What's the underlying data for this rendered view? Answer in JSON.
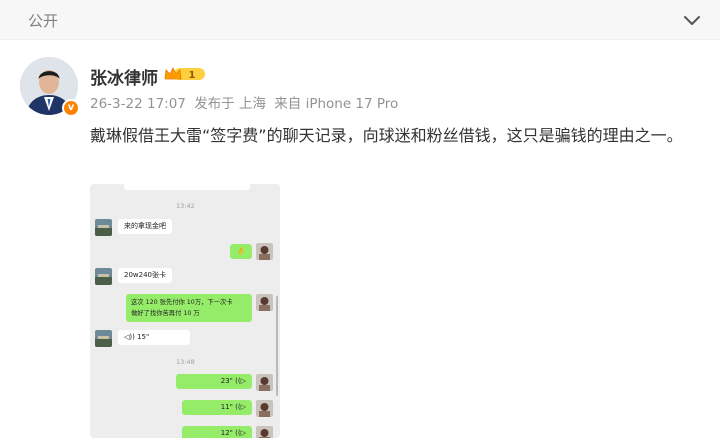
{
  "header": {
    "visibility": "公开"
  },
  "author": {
    "name": "张冰律师",
    "level": "1",
    "verified_mark": "v",
    "date": "26-3-22 17:07",
    "published_from": "发布于 上海",
    "device": "来自 iPhone 17 Pro"
  },
  "post": {
    "text": "戴琳假借王大雷“签字费”的聊天记录，向球迷和粉丝借钱，这只是骗钱的理由之一。"
  },
  "chat": {
    "time1": "13:42",
    "msg1": "来的拿现金吧",
    "msg2_emoji": "👌",
    "msg3": "20w240张卡",
    "msg4_line1": "这次 120 张先付你 10万，下一次卡",
    "msg4_line2": "做好了找你苦再付 10 万",
    "voice1": "15\"",
    "time2": "13:48",
    "voice2": "23\"",
    "voice3": "11\"",
    "voice4": "12\""
  },
  "colors": {
    "accent_orange": "#ff8200",
    "chat_green": "#95ec69",
    "meta_gray": "#939393"
  },
  "icons": [
    "chevron-down-icon",
    "verified-badge-icon",
    "level-crown-icon",
    "voice-wave-icon"
  ]
}
